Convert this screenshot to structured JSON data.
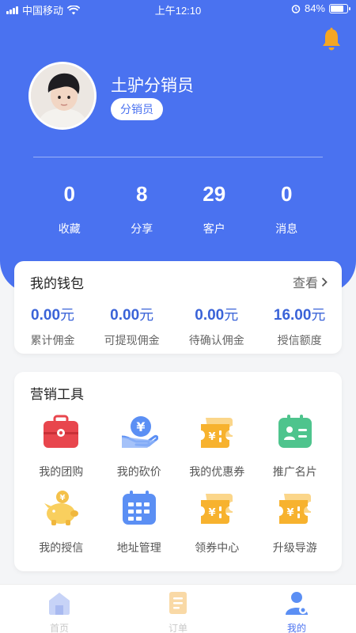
{
  "status_bar": {
    "carrier": "中国移动",
    "time": "上午12:10",
    "battery": "84%",
    "battery_level": 0.84
  },
  "profile": {
    "name": "土驴分销员",
    "role": "分销员"
  },
  "stats": [
    {
      "value": "0",
      "label": "收藏"
    },
    {
      "value": "8",
      "label": "分享"
    },
    {
      "value": "29",
      "label": "客户"
    },
    {
      "value": "0",
      "label": "消息"
    }
  ],
  "wallet": {
    "title": "我的钱包",
    "more": "查看",
    "items": [
      {
        "amount": "0.00",
        "unit": "元",
        "label": "累计佣金"
      },
      {
        "amount": "0.00",
        "unit": "元",
        "label": "可提现佣金"
      },
      {
        "amount": "0.00",
        "unit": "元",
        "label": "待确认佣金"
      },
      {
        "amount": "16.00",
        "unit": "元",
        "label": "授信额度"
      }
    ]
  },
  "tools": {
    "title": "营销工具",
    "items": [
      {
        "label": "我的团购",
        "icon": "group-buy-icon"
      },
      {
        "label": "我的砍价",
        "icon": "bargain-icon"
      },
      {
        "label": "我的优惠券",
        "icon": "coupon-icon"
      },
      {
        "label": "推广名片",
        "icon": "business-card-icon"
      },
      {
        "label": "我的授信",
        "icon": "piggy-bank-icon"
      },
      {
        "label": "地址管理",
        "icon": "calendar-icon"
      },
      {
        "label": "领券中心",
        "icon": "coupon-icon"
      },
      {
        "label": "升级导游",
        "icon": "coupon-icon"
      }
    ]
  },
  "tabbar": [
    {
      "label": "首页",
      "icon": "home-icon",
      "active": false
    },
    {
      "label": "订单",
      "icon": "order-icon",
      "active": false
    },
    {
      "label": "我的",
      "icon": "profile-icon",
      "active": true
    }
  ],
  "colors": {
    "primary": "#4a72f0",
    "amount": "#3a63d8",
    "bell": "#f5a623"
  }
}
